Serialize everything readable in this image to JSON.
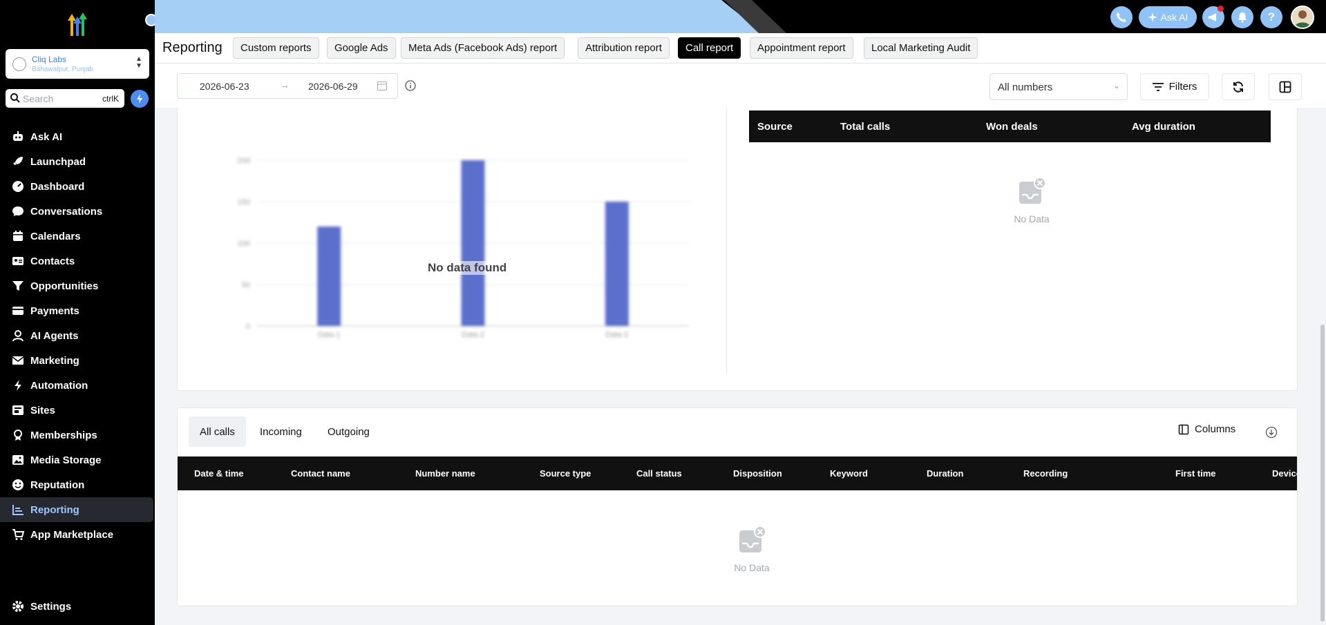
{
  "sidebar": {
    "account": {
      "name": "Cliq Labs",
      "location": "Bahawalpur, Punjab"
    },
    "search": {
      "placeholder": "Search",
      "shortcut": "ctrlK"
    },
    "items": [
      {
        "label": "Ask AI",
        "icon": "robot-icon"
      },
      {
        "label": "Launchpad",
        "icon": "rocket-icon"
      },
      {
        "label": "Dashboard",
        "icon": "gauge-icon"
      },
      {
        "label": "Conversations",
        "icon": "chat-icon"
      },
      {
        "label": "Calendars",
        "icon": "calendar-icon"
      },
      {
        "label": "Contacts",
        "icon": "contact-card-icon"
      },
      {
        "label": "Opportunities",
        "icon": "funnel-icon"
      },
      {
        "label": "Payments",
        "icon": "credit-card-icon"
      },
      {
        "label": "AI Agents",
        "icon": "agent-icon"
      },
      {
        "label": "Marketing",
        "icon": "mail-icon"
      },
      {
        "label": "Automation",
        "icon": "bolt-icon"
      },
      {
        "label": "Sites",
        "icon": "sites-icon"
      },
      {
        "label": "Memberships",
        "icon": "badge-icon"
      },
      {
        "label": "Media Storage",
        "icon": "image-icon"
      },
      {
        "label": "Reputation",
        "icon": "smiley-icon"
      },
      {
        "label": "Reporting",
        "icon": "chart-icon",
        "active": true
      },
      {
        "label": "App Marketplace",
        "icon": "cart-icon"
      }
    ],
    "settings_label": "Settings"
  },
  "topbar": {
    "ask_ai_label": "Ask AI"
  },
  "header": {
    "title": "Reporting",
    "tabs": [
      {
        "label": "Custom reports"
      },
      {
        "label": "Google Ads"
      },
      {
        "label": "Meta Ads (Facebook Ads) report"
      },
      {
        "label": "Attribution report"
      },
      {
        "label": "Call report",
        "active": true
      },
      {
        "label": "Appointment report"
      },
      {
        "label": "Local Marketing Audit"
      }
    ]
  },
  "filters": {
    "start_date": "2026-06-23",
    "end_date": "2026-06-29",
    "numbers_select": "All numbers",
    "filters_label": "Filters"
  },
  "chart_data": {
    "type": "bar",
    "categories": [
      "Data 1",
      "Data 2",
      "Data 3"
    ],
    "values": [
      120,
      200,
      150
    ],
    "ylim": [
      0,
      200
    ],
    "yticks": [
      0,
      50,
      100,
      150,
      200
    ],
    "overlay_text": "No data found",
    "bar_color": "#5b6fcc"
  },
  "source_table": {
    "columns": [
      "Source",
      "Total calls",
      "Won deals",
      "Avg duration"
    ],
    "empty_text": "No Data"
  },
  "calls": {
    "tabs": [
      "All calls",
      "Incoming",
      "Outgoing"
    ],
    "columns_label": "Columns",
    "columns": [
      "Date & time",
      "Contact name",
      "Number name",
      "Source type",
      "Call status",
      "Disposition",
      "Keyword",
      "Duration",
      "Recording",
      "First time",
      "Device"
    ],
    "empty_text": "No Data"
  }
}
